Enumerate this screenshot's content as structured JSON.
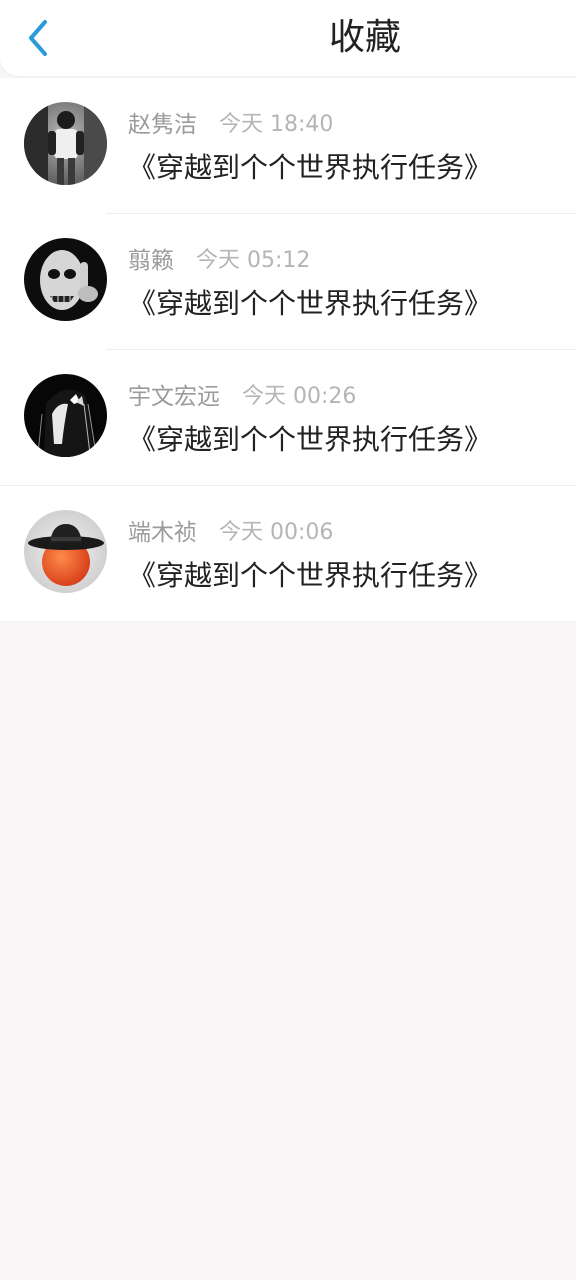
{
  "header": {
    "title": "收藏",
    "back_icon": "chevron-left-icon",
    "accent_color": "#2a9ad8"
  },
  "items": [
    {
      "name": "赵隽洁",
      "time": "今天 18:40",
      "title": "《穿越到个个世界执行任务》",
      "avatar": "avatar-boy-bw"
    },
    {
      "name": "翦籁",
      "time": "今天 05:12",
      "title": "《穿越到个个世界执行任务》",
      "avatar": "avatar-skull-face-bw"
    },
    {
      "name": "宇文宏远",
      "time": "今天 00:26",
      "title": "《穿越到个个世界执行任务》",
      "avatar": "avatar-girl-butterfly"
    },
    {
      "name": "端木祯",
      "time": "今天 00:06",
      "title": "《穿越到个个世界执行任务》",
      "avatar": "avatar-orange-hat"
    }
  ]
}
